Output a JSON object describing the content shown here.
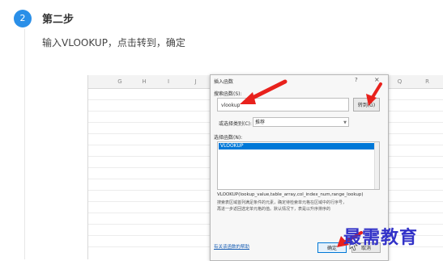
{
  "step": {
    "number": "2",
    "title": "第二步",
    "description": "输入VLOOKUP，点击转到，确定"
  },
  "spreadsheet": {
    "columns": [
      "G",
      "H",
      "I",
      "J",
      "Q",
      "R"
    ]
  },
  "dialog": {
    "title": "插入函数",
    "help_glyph": "?",
    "close_glyph": "×",
    "search_label": "搜索函数(S):",
    "search_value": "vlookup",
    "goto_button": "转到(G)",
    "category_label": "或选择类别(C):",
    "category_value": "推荐",
    "function_list_label": "选择函数(N):",
    "functions": [
      "VLOOKUP"
    ],
    "syntax": "VLOOKUP(lookup_value,table_array,col_index_num,range_lookup)",
    "description_lines": [
      "搜索表区域首列满足条件的元素，确定待检索单元格在区域中的行序号，",
      "再进一步返回选定单元格的值。默认情况下，表是以升序排序的"
    ],
    "help_link": "有关该函数的帮助",
    "ok_button": "确定",
    "cancel_button": "取消"
  },
  "watermark": "最需教育",
  "colors": {
    "step_circle": "#2a8fe8",
    "arrow": "#e8211c",
    "selection": "#0078d7",
    "watermark": "#3232c8"
  }
}
